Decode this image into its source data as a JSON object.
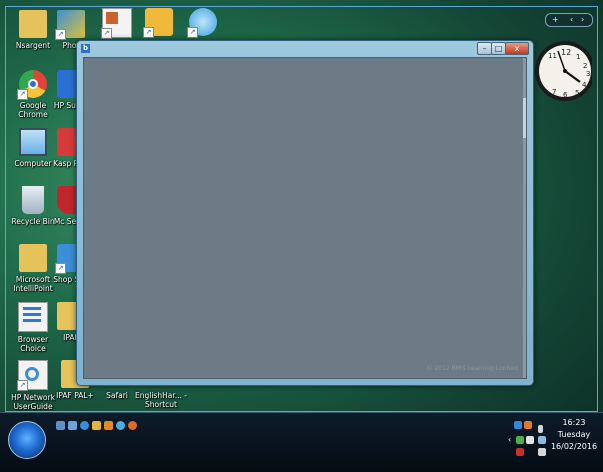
{
  "desktop_icons": [
    {
      "label": "Nsargent",
      "icon": "user-folder-icon",
      "color": "#e6c25a"
    },
    {
      "label": "Phot",
      "icon": "photo-app-icon",
      "color": "#3a8fd6"
    },
    {
      "label": "",
      "icon": "document-icon",
      "color": "#c9622f"
    },
    {
      "label": "",
      "icon": "folder-shortcut-icon",
      "color": "#f0b93a"
    },
    {
      "label": "",
      "icon": "quicktime-icon",
      "color": "#3aa0e0"
    },
    {
      "label": "Google Chrome",
      "icon": "chrome-icon",
      "color": "#e04437"
    },
    {
      "label": "HP Su Ce",
      "icon": "hp-support-icon",
      "color": "#2a6fd1"
    },
    {
      "label": "Computer",
      "icon": "computer-icon",
      "color": "#6ab0e6"
    },
    {
      "label": "Kasp PUR",
      "icon": "kaspersky-icon",
      "color": "#d63a3a"
    },
    {
      "label": "Recycle Bin",
      "icon": "recycle-bin-icon",
      "color": "#b9c7d3"
    },
    {
      "label": "Mc Secur",
      "icon": "mcafee-icon",
      "color": "#c0262d"
    },
    {
      "label": "Microsoft IntelliPoint",
      "icon": "intellipoint-folder-icon",
      "color": "#e6c25a"
    },
    {
      "label": "Shop Sup",
      "icon": "shop-icon",
      "color": "#3a8fd6"
    },
    {
      "label": "Browser Choice",
      "icon": "browser-choice-icon",
      "color": "#2e7ad1"
    },
    {
      "label": "IPAF",
      "icon": "folder-icon",
      "color": "#e6c25a"
    },
    {
      "label": "HP Network UserGuide",
      "icon": "ie-shortcut-icon",
      "color": "#3a8fd6"
    },
    {
      "label": "IPAF PAL+",
      "icon": "folder-icon",
      "color": "#e6c25a"
    },
    {
      "label": "Safari",
      "icon": "safari-icon",
      "color": "#3a8fd6"
    },
    {
      "label": "EnglishHar... - Shortcut",
      "icon": "shortcut-icon",
      "color": "#3a8fd6"
    }
  ],
  "window": {
    "app_icon": "b",
    "minimize": "–",
    "maximize": "□",
    "close": "x",
    "copyright": "© 2012 RM's Learning Limited"
  },
  "clock_gadget": {
    "numerals": [
      "12",
      "1",
      "2",
      "3",
      "4",
      "5",
      "6",
      "7",
      "11"
    ]
  },
  "gadget_bar": {
    "add": "+",
    "prev": "‹",
    "next": "›"
  },
  "taskbar": {
    "quick_launch": [
      {
        "icon": "desktop-icon",
        "color": "#5f8fc8"
      },
      {
        "icon": "switch-windows-icon",
        "color": "#6fa3d8"
      },
      {
        "icon": "ie-icon",
        "color": "#3a8fd6"
      },
      {
        "icon": "mail-icon",
        "color": "#e7b43a"
      },
      {
        "icon": "media-player-icon",
        "color": "#e0882a"
      },
      {
        "icon": "globe-icon",
        "color": "#4ab0e0"
      },
      {
        "icon": "firefox-icon",
        "color": "#e06a2a"
      }
    ],
    "time": "16:23",
    "day": "Tuesday",
    "date": "16/02/2016"
  }
}
